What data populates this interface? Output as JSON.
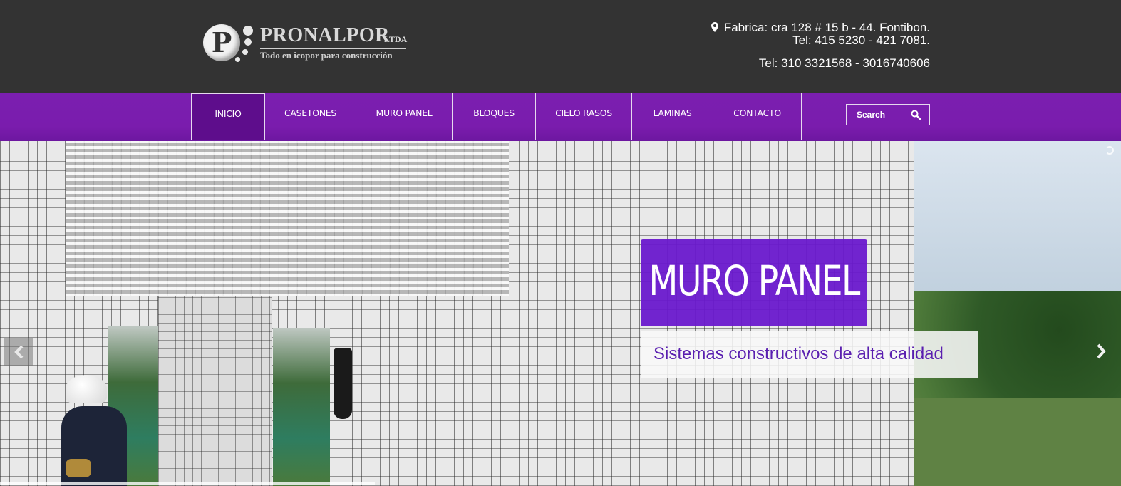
{
  "brand": {
    "logo_letter": "P",
    "name": "PRONALPOR",
    "suffix": "LTDA",
    "tagline": "Todo en icopor para construcción"
  },
  "contact": {
    "address": "Fabrica: cra 128 # 15 b - 44. Fontibon.",
    "phone_landline": "Tel: 415 5230 - 421 7081.",
    "phone_mobile": "Tel: 310 3321568 - 3016740606",
    "icon": "map-pin-icon"
  },
  "nav": {
    "items": [
      {
        "label": "INICIO",
        "active": true
      },
      {
        "label": "CASETONES"
      },
      {
        "label": "MURO PANEL"
      },
      {
        "label": "BLOQUES"
      },
      {
        "label": "CIELO RASOS"
      },
      {
        "label": "LAMINAS"
      },
      {
        "label": "CONTACTO"
      }
    ],
    "search": {
      "placeholder": "Search",
      "icon": "search-icon"
    }
  },
  "slider": {
    "title": "MURO PANEL",
    "subtitle": "Sistemas constructivos de alta calidad",
    "prev_icon": "chevron-left-icon",
    "next_icon": "chevron-right-icon"
  },
  "colors": {
    "header_bg": "#333333",
    "nav_purple": "#7a1cad",
    "nav_active": "#5e0d8c",
    "caption_purple": "#6a19cd",
    "subtitle_text": "#5a1fb0"
  }
}
